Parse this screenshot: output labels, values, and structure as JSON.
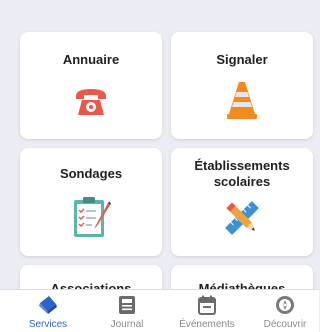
{
  "cards": [
    {
      "title": "Annuaire",
      "icon": "telephone-icon"
    },
    {
      "title": "Signaler",
      "icon": "traffic-cone-icon"
    },
    {
      "title": "Sondages",
      "icon": "clipboard-checklist-icon"
    },
    {
      "title": "Établissements scolaires",
      "icon": "pencil-ruler-icon"
    },
    {
      "title": "Associations",
      "icon": "associations-icon"
    },
    {
      "title": "Médiathèques",
      "icon": "library-icon"
    }
  ],
  "nav": {
    "items": [
      {
        "label": "Services",
        "icon": "services-icon",
        "active": true
      },
      {
        "label": "Journal",
        "icon": "newspaper-icon",
        "active": false
      },
      {
        "label": "Événements",
        "icon": "calendar-icon",
        "active": false
      },
      {
        "label": "Découvrir",
        "icon": "compass-icon",
        "active": false
      }
    ]
  },
  "colors": {
    "accent": "#2f63c9",
    "background": "#ecedf4",
    "phone": "#e8594a",
    "cone": "#f28a1e"
  }
}
